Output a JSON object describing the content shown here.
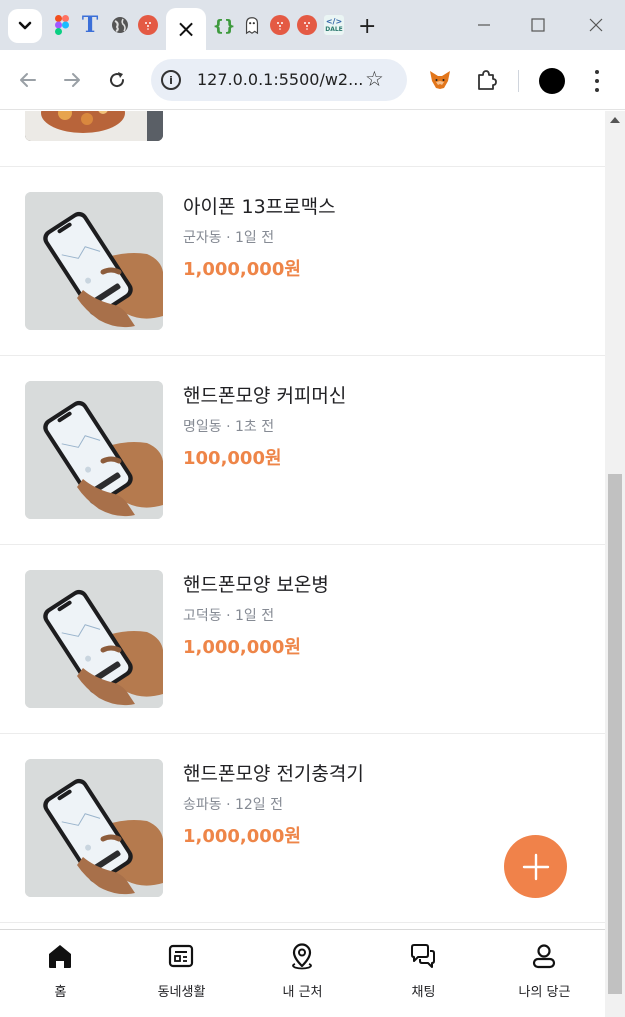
{
  "browser": {
    "url": "127.0.0.1:5500/w2...",
    "tabs": {
      "active_close": "×",
      "dale_label": "DALE"
    },
    "new_tab_label": "+"
  },
  "items": [
    {
      "title": "아이폰 13프로맥스",
      "meta": "군자동 · 1일 전",
      "price": "1,000,000원"
    },
    {
      "title": "핸드폰모양 커피머신",
      "meta": "명일동 · 1초 전",
      "price": "100,000원"
    },
    {
      "title": "핸드폰모양 보온병",
      "meta": "고덕동 · 1일 전",
      "price": "1,000,000원"
    },
    {
      "title": "핸드폰모양 전기충격기",
      "meta": "송파동 · 12일 전",
      "price": "1,000,000원"
    }
  ],
  "bottom_nav": [
    {
      "label": "홈",
      "icon": "home-icon"
    },
    {
      "label": "동네생활",
      "icon": "newspaper-icon"
    },
    {
      "label": "내 근처",
      "icon": "location-pin-icon"
    },
    {
      "label": "채팅",
      "icon": "chat-bubbles-icon"
    },
    {
      "label": "나의 당근",
      "icon": "user-icon"
    }
  ],
  "colors": {
    "accent": "#ee8548",
    "fab": "#f0824a",
    "text": "#212124",
    "meta": "#868b94"
  }
}
